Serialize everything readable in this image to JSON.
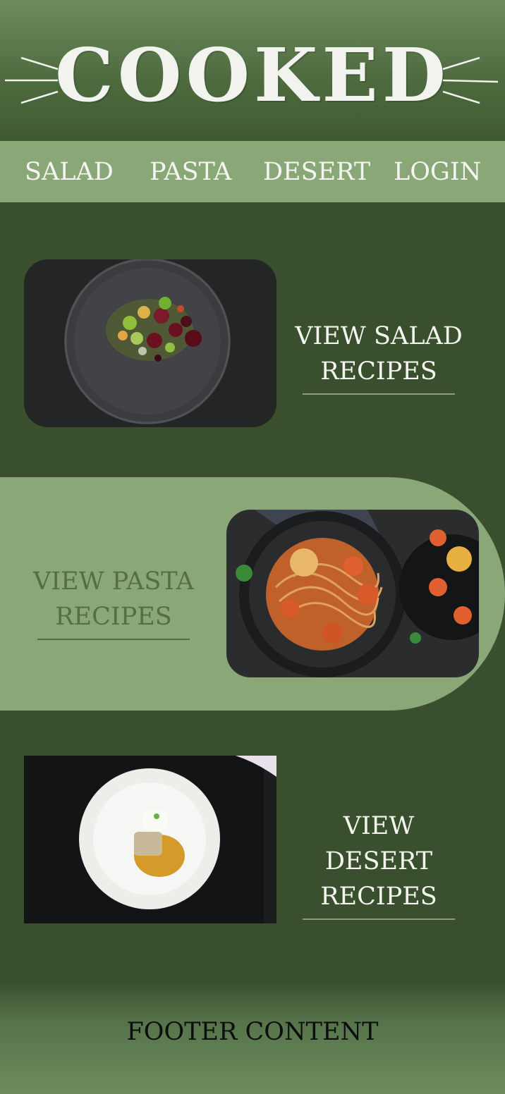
{
  "brand": {
    "logo": "COOKED"
  },
  "nav": {
    "items": [
      {
        "label": "SALAD"
      },
      {
        "label": "PASTA"
      },
      {
        "label": "DESERT"
      },
      {
        "label": "LOGIN"
      }
    ]
  },
  "sections": [
    {
      "cta_line1": "VIEW SALAD",
      "cta_line2": "RECIPES"
    },
    {
      "cta_line1": "VIEW PASTA",
      "cta_line2": "RECIPES"
    },
    {
      "cta_line1": "VIEW DESERT",
      "cta_line2": "RECIPES"
    }
  ],
  "footer": {
    "text": "FOOTER CONTENT"
  },
  "colors": {
    "background": "#3a4f2d",
    "light_green": "#8aa778",
    "header_green": "#5c7a4d",
    "text_light": "#f5f5f0",
    "text_muted_green": "#566e47"
  }
}
